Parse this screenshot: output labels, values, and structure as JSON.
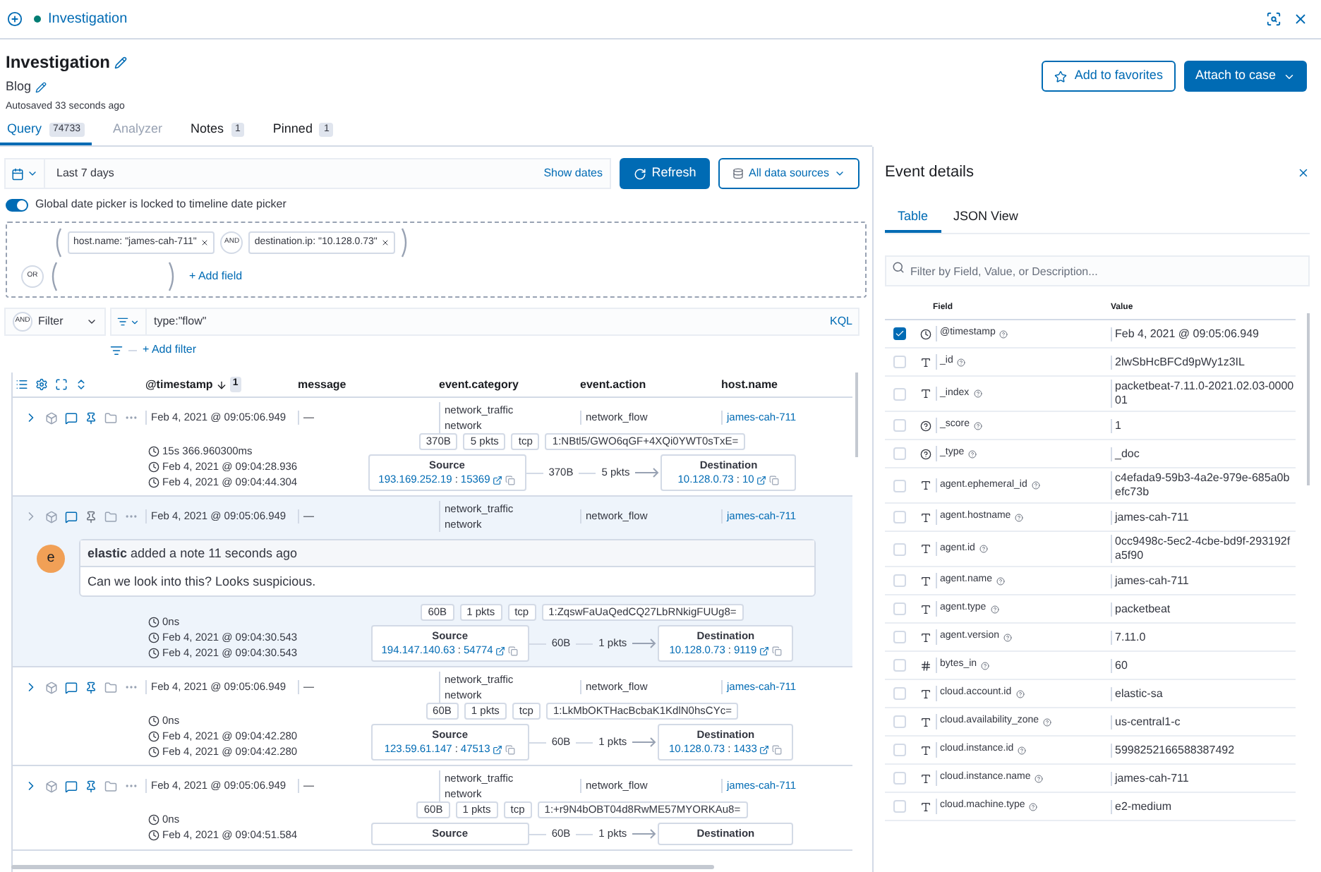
{
  "top_bar": {
    "title": "Investigation"
  },
  "header": {
    "title": "Investigation",
    "description": "Blog",
    "autosave": "Autosaved 33 seconds ago",
    "buttons": [
      {
        "label": "Add to favorites",
        "kind": "secondary"
      },
      {
        "label": "Attach to case",
        "kind": "primary"
      }
    ]
  },
  "tabs": [
    {
      "label": "Query",
      "count": "74733",
      "selected": true,
      "disabled": false
    },
    {
      "label": "Analyzer",
      "selected": false,
      "disabled": true
    },
    {
      "label": "Notes",
      "count": "1",
      "selected": false,
      "disabled": false
    },
    {
      "label": "Pinned",
      "count": "1",
      "selected": false,
      "disabled": false
    }
  ],
  "date_picker": {
    "range": "Last 7 days",
    "show_dates": "Show dates"
  },
  "refresh_button": "Refresh",
  "data_sources_button": "All data sources",
  "lock_toggle": {
    "label": "Global date picker is locked to timeline date picker",
    "on": true
  },
  "query_builder": {
    "fields": [
      "host.name: \"james-cah-711\"",
      "destination.ip: \"10.128.0.73\""
    ],
    "and_label": "AND",
    "or_label": "OR",
    "add_field": "+ Add field"
  },
  "filter_bar": {
    "and_label": "AND",
    "filter_label": "Filter",
    "query": "type:\"flow\"",
    "language": "KQL",
    "add_filter": "+ Add filter"
  },
  "table": {
    "columns": [
      {
        "label": "@timestamp",
        "sort_badge": "1"
      },
      {
        "label": "message"
      },
      {
        "label": "event.category"
      },
      {
        "label": "event.action"
      },
      {
        "label": "host.name"
      }
    ],
    "rows": [
      {
        "timestamp": "Feb 4, 2021 @ 09:05:06.949",
        "message": "—",
        "category": [
          "network_traffic",
          "network"
        ],
        "action": "network_flow",
        "host": "james-cah-711",
        "highlighted": false,
        "flow": {
          "duration": "15s 366.960300ms",
          "start": "Feb 4, 2021 @ 09:04:28.936",
          "end": "Feb 4, 2021 @ 09:04:44.304",
          "bytes": "370B",
          "packets": "5 pkts",
          "transport": "tcp",
          "community_id": "1:NBtl5/GWO6qGF+4XQi0YWT0sTxE=",
          "source_label": "Source",
          "source_ip": "193.169.252.19",
          "separator": ":",
          "source_port": "15369",
          "flow_bytes": "370B",
          "flow_packets": "5 pkts",
          "dest_label": "Destination",
          "dest_ip": "10.128.0.73",
          "dest_port": "10"
        }
      },
      {
        "timestamp": "Feb 4, 2021 @ 09:05:06.949",
        "message": "—",
        "category": [
          "network_traffic",
          "network"
        ],
        "action": "network_flow",
        "host": "james-cah-711",
        "highlighted": true,
        "note": {
          "avatar": "e",
          "header": "**elastic** added a note 11 seconds ago",
          "text": "Can we look into this? Looks suspicious."
        },
        "flow": {
          "duration": "0ns",
          "start": "Feb 4, 2021 @ 09:04:30.543",
          "end": "Feb 4, 2021 @ 09:04:30.543",
          "bytes": "60B",
          "packets": "1 pkts",
          "transport": "tcp",
          "community_id": "1:ZqswFaUaQedCQ27LbRNkigFUUg8=",
          "source_label": "Source",
          "source_ip": "194.147.140.63",
          "separator": ":",
          "source_port": "54774",
          "flow_bytes": "60B",
          "flow_packets": "1 pkts",
          "dest_label": "Destination",
          "dest_ip": "10.128.0.73",
          "dest_port": "9119"
        }
      },
      {
        "timestamp": "Feb 4, 2021 @ 09:05:06.949",
        "message": "—",
        "category": [
          "network_traffic",
          "network"
        ],
        "action": "network_flow",
        "host": "james-cah-711",
        "highlighted": false,
        "flow": {
          "duration": "0ns",
          "start": "Feb 4, 2021 @ 09:04:42.280",
          "end": "Feb 4, 2021 @ 09:04:42.280",
          "bytes": "60B",
          "packets": "1 pkts",
          "transport": "tcp",
          "community_id": "1:LkMbOKTHacBcbaK1KdlN0hsCYc=",
          "source_label": "Source",
          "source_ip": "123.59.61.147",
          "separator": ":",
          "source_port": "47513",
          "flow_bytes": "60B",
          "flow_packets": "1 pkts",
          "dest_label": "Destination",
          "dest_ip": "10.128.0.73",
          "dest_port": "1433"
        }
      },
      {
        "timestamp": "Feb 4, 2021 @ 09:05:06.949",
        "message": "—",
        "category": [
          "network_traffic",
          "network"
        ],
        "action": "network_flow",
        "host": "james-cah-711",
        "highlighted": false,
        "flow": {
          "duration": "0ns",
          "start": "Feb 4, 2021 @ 09:04:51.584",
          "bytes": "60B",
          "packets": "1 pkts",
          "transport": "tcp",
          "community_id": "1:+r9N4bOBT04d8RwME57MYORKAu8=",
          "source_label": "Source",
          "flow_bytes": "60B",
          "flow_packets": "1 pkts",
          "dest_label": "Destination"
        }
      }
    ]
  },
  "event_details": {
    "title": "Event details",
    "tabs": [
      {
        "label": "Table",
        "selected": true
      },
      {
        "label": "JSON View",
        "selected": false
      }
    ],
    "search_placeholder": "Filter by Field, Value, or Description...",
    "columns": [
      "Field",
      "Value"
    ],
    "fields": [
      {
        "kind": "date",
        "name": "@timestamp",
        "value": "Feb 4, 2021 @ 09:05:06.949",
        "checked": true
      },
      {
        "kind": "string",
        "name": "_id",
        "value": "2lwSbHcBFCd9pWy1z3IL",
        "checked": false
      },
      {
        "kind": "string",
        "name": "_index",
        "value": "packetbeat-7.11.0-2021.02.03-000001",
        "checked": false
      },
      {
        "kind": "unknown",
        "name": "_score",
        "value": "1",
        "checked": false
      },
      {
        "kind": "unknown",
        "name": "_type",
        "value": "_doc",
        "checked": false
      },
      {
        "kind": "string",
        "name": "agent.ephemeral_id",
        "value": "c4efada9-59b3-4a2e-979e-685a0befc73b",
        "checked": false
      },
      {
        "kind": "string",
        "name": "agent.hostname",
        "value": "james-cah-711",
        "checked": false
      },
      {
        "kind": "string",
        "name": "agent.id",
        "value": "0cc9498c-5ec2-4cbe-bd9f-293192fa5f90",
        "checked": false
      },
      {
        "kind": "string",
        "name": "agent.name",
        "value": "james-cah-711",
        "checked": false
      },
      {
        "kind": "string",
        "name": "agent.type",
        "value": "packetbeat",
        "checked": false
      },
      {
        "kind": "string",
        "name": "agent.version",
        "value": "7.11.0",
        "checked": false
      },
      {
        "kind": "number",
        "name": "bytes_in",
        "value": "60",
        "checked": false
      },
      {
        "kind": "string",
        "name": "cloud.account.id",
        "value": "elastic-sa",
        "checked": false
      },
      {
        "kind": "string",
        "name": "cloud.availability_zone",
        "value": "us-central1-c",
        "checked": false
      },
      {
        "kind": "string",
        "name": "cloud.instance.id",
        "value": "5998252166588387492",
        "checked": false
      },
      {
        "kind": "string",
        "name": "cloud.instance.name",
        "value": "james-cah-711",
        "checked": false
      },
      {
        "kind": "string",
        "name": "cloud.machine.type",
        "value": "e2-medium",
        "checked": false
      }
    ]
  }
}
